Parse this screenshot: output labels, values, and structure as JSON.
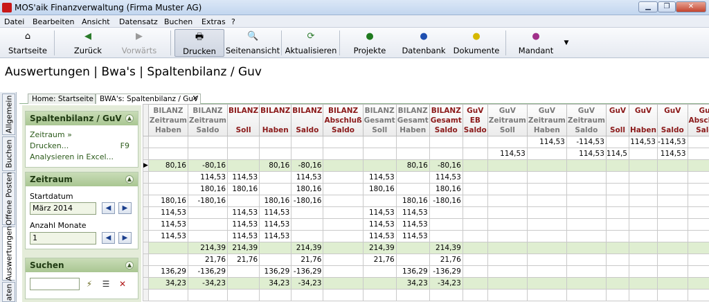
{
  "window": {
    "title": "MOS'aik Finanzverwaltung (Firma Muster AG)",
    "controls": [
      "minimize",
      "restore",
      "close"
    ]
  },
  "menu": [
    "Datei",
    "Bearbeiten",
    "Ansicht",
    "Datensatz",
    "Buchen",
    "Extras",
    "?"
  ],
  "toolbar": {
    "startseite": "Startseite",
    "zurueck": "Zurück",
    "vorwaerts": "Vorwärts",
    "drucken": "Drucken",
    "seitenansicht": "Seitenansicht",
    "aktualisieren": "Aktualisieren",
    "projekte": "Projekte",
    "datenbank": "Datenbank",
    "dokumente": "Dokumente",
    "mandant": "Mandant"
  },
  "page_title": "Auswertungen | Bwa's | Spaltenbilanz / Guv",
  "left_tabs": [
    "Allgemein",
    "Buchen",
    "Offene Posten",
    "Auswertungen",
    "aten"
  ],
  "doc_tabs": [
    {
      "label": "Home: Startseite",
      "active": false
    },
    {
      "label": "BWA's: Spaltenbilanz / GuV",
      "active": true
    }
  ],
  "panel": {
    "group1": {
      "title": "Spaltenbilanz / GuV",
      "links": [
        "Zeitraum »",
        "Drucken...",
        "Analysieren in Excel..."
      ],
      "drucken_key": "F9"
    },
    "group2": {
      "title": "Zeitraum",
      "start_label": "Startdatum",
      "start_value": "März 2014",
      "months_label": "Anzahl Monate",
      "months_value": "1"
    },
    "group3": {
      "title": "Suchen",
      "search_value": ""
    }
  },
  "grid": {
    "columns": [
      {
        "l1": "BILANZ",
        "l2": "Zeitraum",
        "l3": "Haben",
        "red": false
      },
      {
        "l1": "BILANZ",
        "l2": "Zeitraum",
        "l3": "Saldo",
        "red": false
      },
      {
        "l1": "BILANZ",
        "l2": "",
        "l3": "Soll",
        "red": true
      },
      {
        "l1": "BILANZ",
        "l2": "",
        "l3": "Haben",
        "red": true
      },
      {
        "l1": "BILANZ",
        "l2": "",
        "l3": "Saldo",
        "red": true
      },
      {
        "l1": "BILANZ",
        "l2": "Abschluß",
        "l3": "Saldo",
        "red": true
      },
      {
        "l1": "BILANZ",
        "l2": "Gesamt",
        "l3": "Soll",
        "red": false
      },
      {
        "l1": "BILANZ",
        "l2": "Gesamt",
        "l3": "Haben",
        "red": false
      },
      {
        "l1": "BILANZ",
        "l2": "Gesamt",
        "l3": "Saldo",
        "red": true
      },
      {
        "l1": "GuV",
        "l2": "EB",
        "l3": "Saldo",
        "red": true
      },
      {
        "l1": "GuV",
        "l2": "Zeitraum",
        "l3": "Soll",
        "red": false
      },
      {
        "l1": "GuV",
        "l2": "Zeitraum",
        "l3": "Haben",
        "red": false
      },
      {
        "l1": "GuV",
        "l2": "Zeitraum",
        "l3": "Saldo",
        "red": false
      },
      {
        "l1": "GuV",
        "l2": "",
        "l3": "Soll",
        "red": true
      },
      {
        "l1": "GuV",
        "l2": "",
        "l3": "Haben",
        "red": true
      },
      {
        "l1": "GuV",
        "l2": "",
        "l3": "Saldo",
        "red": true
      },
      {
        "l1": "GuV",
        "l2": "Abschluß",
        "l3": "Saldo",
        "red": true
      },
      {
        "l1": "G",
        "l2": "",
        "l3": "",
        "red": false
      }
    ],
    "rows": [
      {
        "green": false,
        "current": false,
        "cells": [
          "",
          "",
          "",
          "",
          "",
          "",
          "",
          "",
          "",
          "",
          "",
          "114,53",
          "-114,53",
          "",
          "114,53",
          "-114,53",
          "",
          ""
        ]
      },
      {
        "green": false,
        "current": false,
        "cells": [
          "",
          "",
          "",
          "",
          "",
          "",
          "",
          "",
          "",
          "",
          "114,53",
          "",
          "114,53",
          "114,5",
          "",
          "114,53",
          "",
          ""
        ]
      },
      {
        "green": true,
        "current": true,
        "cells": [
          "80,16",
          "-80,16",
          "",
          "80,16",
          "-80,16",
          "",
          "",
          "80,16",
          "-80,16",
          "",
          "",
          "",
          "",
          "",
          "",
          "",
          "",
          ""
        ]
      },
      {
        "green": false,
        "current": false,
        "cells": [
          "",
          "114,53",
          "114,53",
          "",
          "114,53",
          "",
          "114,53",
          "",
          "114,53",
          "",
          "",
          "",
          "",
          "",
          "",
          "",
          "",
          ""
        ]
      },
      {
        "green": false,
        "current": false,
        "cells": [
          "",
          "180,16",
          "180,16",
          "",
          "180,16",
          "",
          "180,16",
          "",
          "180,16",
          "",
          "",
          "",
          "",
          "",
          "",
          "",
          "",
          ""
        ]
      },
      {
        "green": false,
        "current": false,
        "cells": [
          "180,16",
          "-180,16",
          "",
          "180,16",
          "-180,16",
          "",
          "",
          "180,16",
          "-180,16",
          "",
          "",
          "",
          "",
          "",
          "",
          "",
          "",
          ""
        ]
      },
      {
        "green": false,
        "current": false,
        "cells": [
          "114,53",
          "",
          "114,53",
          "114,53",
          "",
          "",
          "114,53",
          "114,53",
          "",
          "",
          "",
          "",
          "",
          "",
          "",
          "",
          "",
          ""
        ]
      },
      {
        "green": false,
        "current": false,
        "cells": [
          "114,53",
          "",
          "114,53",
          "114,53",
          "",
          "",
          "114,53",
          "114,53",
          "",
          "",
          "",
          "",
          "",
          "",
          "",
          "",
          "",
          ""
        ]
      },
      {
        "green": false,
        "current": false,
        "cells": [
          "114,53",
          "",
          "114,53",
          "114,53",
          "",
          "",
          "114,53",
          "114,53",
          "",
          "",
          "",
          "",
          "",
          "",
          "",
          "",
          "",
          ""
        ]
      },
      {
        "green": true,
        "current": false,
        "cells": [
          "",
          "214,39",
          "214,39",
          "",
          "214,39",
          "",
          "214,39",
          "",
          "214,39",
          "",
          "",
          "",
          "",
          "",
          "",
          "",
          "",
          ""
        ]
      },
      {
        "green": false,
        "current": false,
        "cells": [
          "",
          "21,76",
          "21,76",
          "",
          "21,76",
          "",
          "21,76",
          "",
          "21,76",
          "",
          "",
          "",
          "",
          "",
          "",
          "",
          "",
          ""
        ]
      },
      {
        "green": false,
        "current": false,
        "cells": [
          "136,29",
          "-136,29",
          "",
          "136,29",
          "-136,29",
          "",
          "",
          "136,29",
          "-136,29",
          "",
          "",
          "",
          "",
          "",
          "",
          "",
          "",
          ""
        ]
      },
      {
        "green": true,
        "current": false,
        "cells": [
          "34,23",
          "-34,23",
          "",
          "34,23",
          "-34,23",
          "",
          "",
          "34,23",
          "-34,23",
          "",
          "",
          "",
          "",
          "",
          "",
          "",
          "",
          ""
        ]
      },
      {
        "green": false,
        "current": false,
        "cells": [
          "",
          "",
          "",
          "",
          "",
          "",
          "",
          "",
          "",
          "",
          "",
          "",
          "",
          "",
          "",
          "",
          "",
          ""
        ]
      }
    ]
  }
}
